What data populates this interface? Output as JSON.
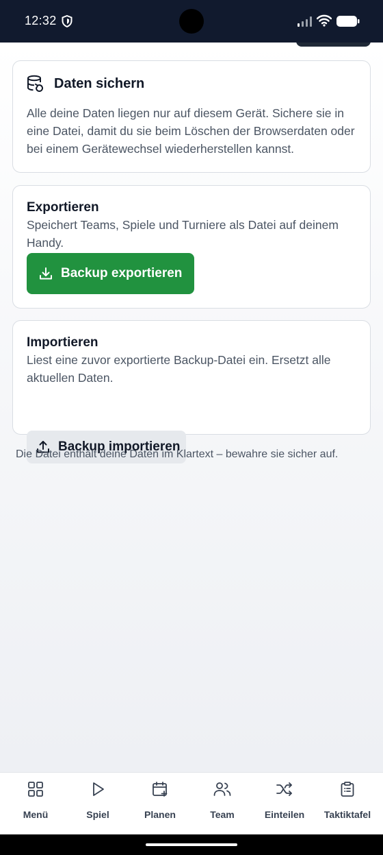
{
  "status_bar": {
    "time": "12:32",
    "icons": [
      "shield-icon",
      "signal-icon",
      "wifi-icon",
      "battery-icon"
    ]
  },
  "info_card": {
    "icon": "database-restore-icon",
    "title": "Daten sichern",
    "text": "Alle deine Daten liegen nur auf diesem Gerät. Sichere sie in eine Datei, damit du sie beim Löschen der Browserdaten oder bei einem Gerätewechsel wiederherstellen kannst."
  },
  "export_card": {
    "title": "Exportieren",
    "text": "Speichert Teams, Spiele und Turniere als Datei auf deinem Handy.",
    "button_label": "Backup exportieren",
    "button_icon": "download-icon"
  },
  "import_card": {
    "title": "Importieren",
    "text": "Liest eine zuvor exportierte Backup-Datei ein. Ersetzt alle aktuellen Daten.",
    "button_label": "Backup importieren",
    "button_icon": "upload-icon"
  },
  "footer_note": "Die Datei enthält deine Daten im Klartext – bewahre sie sicher auf.",
  "bottom_nav": {
    "items": [
      {
        "label": "Menü",
        "icon": "grid-icon"
      },
      {
        "label": "Spiel",
        "icon": "play-icon"
      },
      {
        "label": "Planen",
        "icon": "calendar-plus-icon"
      },
      {
        "label": "Team",
        "icon": "users-icon"
      },
      {
        "label": "Einteilen",
        "icon": "shuffle-icon"
      },
      {
        "label": "Taktiktafel",
        "icon": "clipboard-icon"
      }
    ]
  },
  "colors": {
    "export_button": "#21923f",
    "import_button": "#e6e9ed",
    "status_bar": "#111a2e"
  }
}
